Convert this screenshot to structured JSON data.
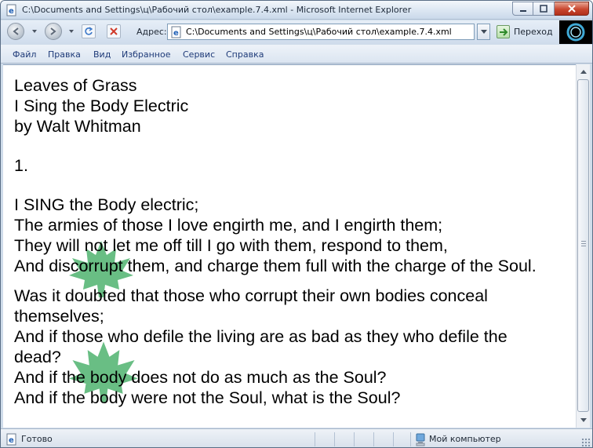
{
  "window": {
    "title": "C:\\Documents and Settings\\ц\\Рабочий стол\\example.7.4.xml - Microsoft Internet Explorer"
  },
  "toolbar": {
    "address_label": "Адрес:",
    "address_value": "C:\\Documents and Settings\\ц\\Рабочий стол\\example.7.4.xml",
    "go_label": "Переход"
  },
  "menu": {
    "items": [
      "Файл",
      "Правка",
      "Вид",
      "Избранное",
      "Сервис",
      "Справка"
    ]
  },
  "document": {
    "header": [
      "Leaves of Grass",
      "I Sing the Body Electric",
      "by Walt Whitman"
    ],
    "section_number": "1.",
    "stanza1": [
      "I SING the Body electric;",
      "The armies of those I love engirth me, and I engirth them;",
      "They will not let me off till I go with them, respond to them,",
      "And discorrupt them, and charge them full with the charge of the Soul."
    ],
    "stanza2": [
      "Was it doubted that those who corrupt their own bodies conceal themselves;",
      "And if those who defile the living are as bad as they who defile the dead?",
      "And if the body does not do as much as the Soul?",
      "And if the body were not the Soul, what is the Soul?"
    ]
  },
  "statusbar": {
    "status_text": "Готово",
    "zone_text": "Мой компьютер"
  },
  "colors": {
    "leaf": "#5cb87a",
    "menu_text": "#1e3a78"
  }
}
